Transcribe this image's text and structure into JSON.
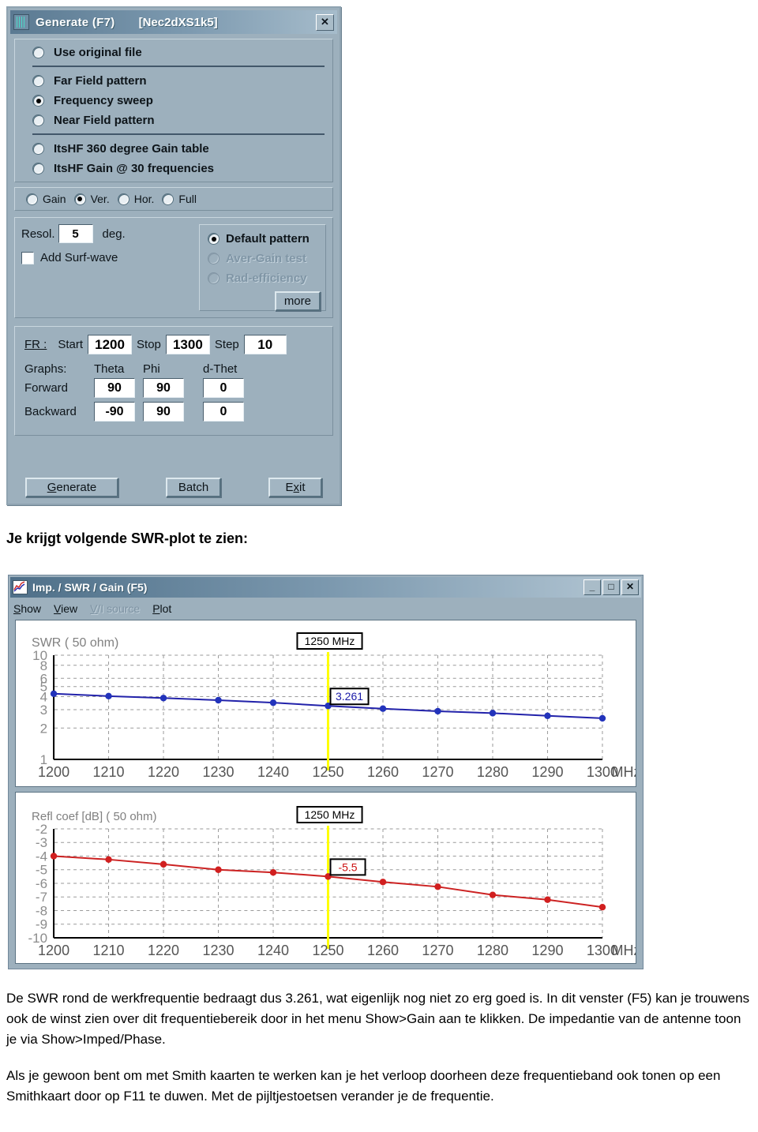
{
  "generate_dialog": {
    "title": "Generate (F7)",
    "title_suffix": "[Nec2dXS1k5]",
    "close_label": "✕",
    "icon": "antenna-icon",
    "options_primary": [
      {
        "label": "Use original file",
        "checked": false
      }
    ],
    "options_pattern": [
      {
        "label": "Far Field pattern",
        "checked": false
      },
      {
        "label": "Frequency sweep",
        "checked": true
      },
      {
        "label": "Near Field pattern",
        "checked": false
      }
    ],
    "options_itshf": [
      {
        "label": "ItsHF 360 degree Gain table",
        "checked": false
      },
      {
        "label": "ItsHF Gain @ 30 frequencies",
        "checked": false
      }
    ],
    "options_gain": [
      {
        "label": "Gain",
        "checked": false
      },
      {
        "label": "Ver.",
        "checked": true
      },
      {
        "label": "Hor.",
        "checked": false
      },
      {
        "label": "Full",
        "checked": false
      }
    ],
    "resol_label": "Resol.",
    "resol_value": "5",
    "resol_unit": "deg.",
    "add_surf_wave_label": "Add Surf-wave",
    "add_surf_wave_checked": false,
    "options_pattern_type": [
      {
        "label": "Default pattern",
        "checked": true,
        "disabled": false
      },
      {
        "label": "Aver-Gain test",
        "checked": false,
        "disabled": true
      },
      {
        "label": "Rad-efficiency",
        "checked": false,
        "disabled": true
      }
    ],
    "more_button": "more",
    "fr_label": "FR :",
    "start_label": "Start",
    "start_value": "1200",
    "stop_label": "Stop",
    "stop_value": "1300",
    "step_label": "Step",
    "step_value": "10",
    "graphs_label": "Graphs:",
    "col_theta": "Theta",
    "col_phi": "Phi",
    "col_dthet": "d-Thet",
    "row_forward": "Forward",
    "forward_theta": "90",
    "forward_phi": "90",
    "forward_dthet": "0",
    "row_backward": "Backward",
    "backward_theta": "-90",
    "backward_phi": "90",
    "backward_dthet": "0",
    "generate_button": "Generate",
    "generate_button_pre": "G",
    "generate_button_post": "enerate",
    "batch_button": "Batch",
    "exit_button_pre": "E",
    "exit_button_mid": "x",
    "exit_button_post": "it"
  },
  "caption": "Je krijgt volgende SWR-plot te zien:",
  "plot_window": {
    "title": "Imp. / SWR / Gain   (F5)",
    "minimize": "_",
    "maximize": "□",
    "close": "✕",
    "menu": [
      {
        "label": "Show",
        "accel": "S",
        "rest": "how",
        "disabled": false
      },
      {
        "label": "View",
        "accel": "V",
        "rest": "iew",
        "disabled": false
      },
      {
        "label": "V/I source",
        "accel": "V",
        "rest": "/I source",
        "disabled": true
      },
      {
        "label": "Plot",
        "accel": "P",
        "rest": "lot",
        "disabled": false
      }
    ]
  },
  "chart_data": [
    {
      "type": "line",
      "title": "SWR ( 50 ohm)",
      "xlabel": "MHz",
      "ylabel": "SWR",
      "x_unit_label": "MHz",
      "yscale": "log",
      "ylim": [
        1,
        10
      ],
      "xlim": [
        1200,
        1300
      ],
      "yticks": [
        10,
        8,
        6,
        5,
        4,
        3,
        2,
        1
      ],
      "xticks": [
        1200,
        1210,
        1220,
        1230,
        1240,
        1250,
        1260,
        1270,
        1280,
        1290,
        1300
      ],
      "grid": true,
      "color": "#2222aa",
      "marker_color": "#2233bb",
      "cursor_freq": 1250,
      "cursor_label": "1250 MHz",
      "cursor_color": "#ffff00",
      "value_label": "3.261",
      "value_label_color": "#1a1aa8",
      "x": [
        1200,
        1210,
        1220,
        1230,
        1240,
        1250,
        1260,
        1270,
        1280,
        1290,
        1300
      ],
      "values": [
        4.27,
        4.05,
        3.88,
        3.7,
        3.5,
        3.261,
        3.07,
        2.9,
        2.78,
        2.62,
        2.48
      ]
    },
    {
      "type": "line",
      "title": "Refl coef [dB] ( 50 ohm)",
      "xlabel": "MHz",
      "ylabel": "Refl coef [dB]",
      "x_unit_label": "MHz",
      "yscale": "linear",
      "ylim": [
        -10,
        -2
      ],
      "xlim": [
        1200,
        1300
      ],
      "yticks": [
        -2,
        -3,
        -4,
        -5,
        -6,
        -7,
        -8,
        -9,
        -10
      ],
      "xticks": [
        1200,
        1210,
        1220,
        1230,
        1240,
        1250,
        1260,
        1270,
        1280,
        1290,
        1300
      ],
      "grid": true,
      "color": "#cc2222",
      "marker_color": "#d11f1f",
      "cursor_freq": 1250,
      "cursor_label": "1250 MHz",
      "cursor_color": "#ffff00",
      "value_label": "-5.5",
      "value_label_color": "#cc1111",
      "x": [
        1200,
        1210,
        1220,
        1230,
        1240,
        1250,
        1260,
        1270,
        1280,
        1290,
        1300
      ],
      "values": [
        -4.0,
        -4.25,
        -4.6,
        -5.0,
        -5.2,
        -5.5,
        -5.9,
        -6.25,
        -6.85,
        -7.2,
        -7.75
      ]
    }
  ],
  "body": {
    "para1": "De SWR rond de werkfrequentie bedraagt dus 3.261, wat eigenlijk nog niet zo erg goed is. In dit venster (F5) kan je trouwens ook de winst zien over dit frequentiebereik door in het menu Show>Gain aan te klikken. De impedantie van de antenne toon je via Show>Imped/Phase.",
    "para2": "Als je gewoon bent om met Smith kaarten te werken kan je het verloop doorheen deze frequentieband ook tonen op een Smithkaart door op F11 te duwen. Met de pijltjestoetsen verander je de frequentie."
  }
}
